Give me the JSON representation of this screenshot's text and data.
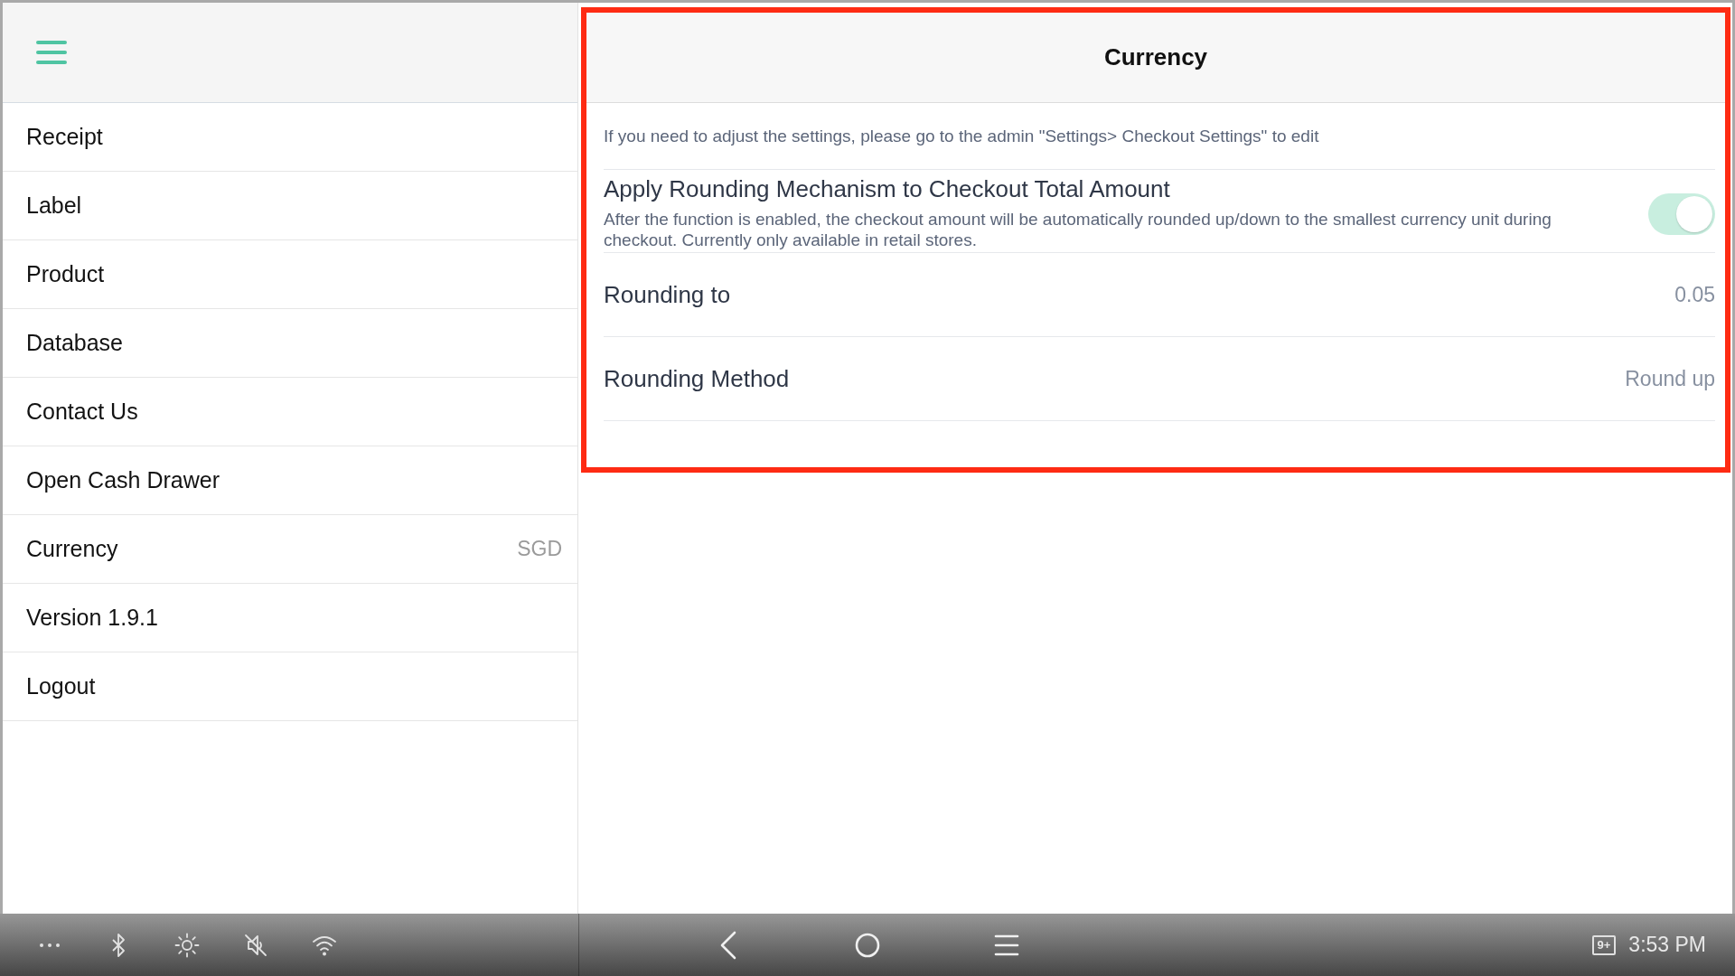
{
  "sidebar": {
    "items": [
      {
        "label": "Receipt"
      },
      {
        "label": "Label"
      },
      {
        "label": "Product"
      },
      {
        "label": "Database"
      },
      {
        "label": "Contact Us"
      },
      {
        "label": "Open Cash Drawer"
      },
      {
        "label": "Currency",
        "value": "SGD"
      },
      {
        "label": "Version 1.9.1"
      },
      {
        "label": "Logout"
      }
    ]
  },
  "panel": {
    "title": "Currency",
    "notice": "If you need to adjust the settings, please go to the admin \"Settings> Checkout Settings\" to edit",
    "settings": [
      {
        "kind": "toggle",
        "label": "Apply Rounding Mechanism to Checkout Total Amount",
        "description": "After the function is enabled, the checkout amount will be automatically rounded up/down to the smallest currency unit during checkout. Currently only available in retail stores.",
        "on": true,
        "disabled": true
      },
      {
        "kind": "value",
        "label": "Rounding to",
        "value": "0.05"
      },
      {
        "kind": "value",
        "label": "Rounding Method",
        "value": "Round up"
      }
    ]
  },
  "status_bar": {
    "notification_count": "9+",
    "time": "3:53 PM"
  }
}
